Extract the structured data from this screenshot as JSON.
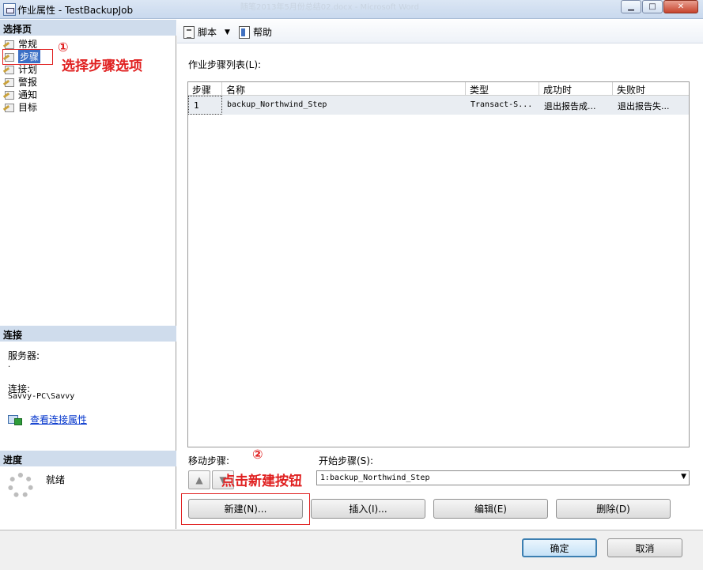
{
  "window": {
    "title": "作业属性 - TestBackupJob",
    "background_title": "随笔2013年5月份总结02.docx - Microsoft Word",
    "controls": {
      "minimize": "▁",
      "maximize": "□",
      "close": "✕"
    }
  },
  "left": {
    "select_page_header": "选择页",
    "nav_items": [
      {
        "label": "常规",
        "icon": "page-icon"
      },
      {
        "label": "步骤",
        "icon": "page-icon",
        "selected": true
      },
      {
        "label": "计划",
        "icon": "page-icon"
      },
      {
        "label": "警报",
        "icon": "page-icon"
      },
      {
        "label": "通知",
        "icon": "page-icon"
      },
      {
        "label": "目标",
        "icon": "page-icon"
      }
    ],
    "connection_header": "连接",
    "server_label": "服务器:",
    "server_value": ".",
    "connection_label": "连接:",
    "connection_value": "Savvy-PC\\Savvy",
    "view_connection_link": "查看连接属性",
    "progress_header": "进度",
    "status": "就绪"
  },
  "annotations": {
    "num1": "①",
    "text1": "选择步骤选项",
    "num2": "②",
    "text2": "点击新建按钮",
    "color": "#e02020"
  },
  "toolbar": {
    "script_label": "脚本",
    "help_label": "帮助"
  },
  "main": {
    "list_label": "作业步骤列表(L):",
    "columns": [
      "步骤",
      "名称",
      "类型",
      "成功时",
      "失败时"
    ],
    "rows": [
      {
        "step": "1",
        "name": "backup_Northwind_Step",
        "type": "Transact-S...",
        "on_success": "退出报告成...",
        "on_failure": "退出报告失..."
      }
    ],
    "move_step_label": "移动步骤:",
    "start_step_label": "开始步骤(S):",
    "start_step_value": "1:backup_Northwind_Step",
    "buttons": {
      "new": "新建(N)...",
      "insert": "插入(I)...",
      "edit": "编辑(E)",
      "delete": "删除(D)"
    }
  },
  "footer": {
    "ok": "确定",
    "cancel": "取消"
  }
}
